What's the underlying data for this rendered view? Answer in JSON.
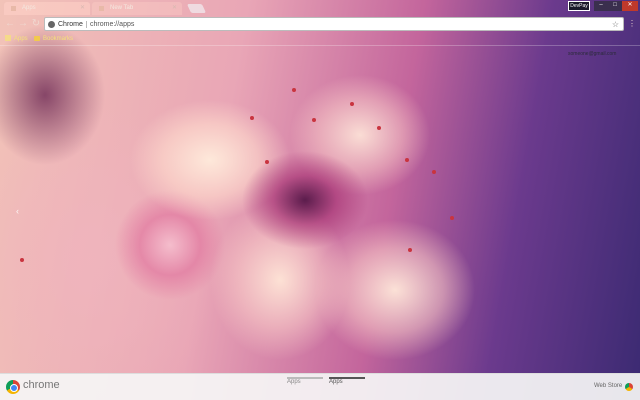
{
  "tabs": [
    {
      "label": "Apps",
      "active": true
    },
    {
      "label": "New Tab",
      "active": false
    }
  ],
  "window": {
    "profile_chip": "DevPay",
    "minimize": "–",
    "maximize": "□",
    "close": "✕"
  },
  "toolbar": {
    "back": "←",
    "forward": "→",
    "reload": "↻",
    "omnibox_chip": "Chrome",
    "url": "chrome://apps",
    "star": "☆",
    "menu": "⋮"
  },
  "bookmarks": {
    "apps": "Apps",
    "bookmarks": "Bookmarks"
  },
  "profile_text": "someone@gmail.com",
  "page_nav_left": "‹",
  "bottom": {
    "brand": "chrome",
    "page_tabs": [
      "Apps",
      "Apps"
    ],
    "web_store": "Web Store"
  },
  "icons": [
    "chrome-icon",
    "star-icon",
    "menu-icon",
    "apps-grid-icon",
    "folder-icon",
    "web-store-icon"
  ],
  "colors": {
    "close_button": "#c0392b",
    "bookmark_text": "#f6e27a",
    "bottom_bar": "#f5f5f5"
  }
}
